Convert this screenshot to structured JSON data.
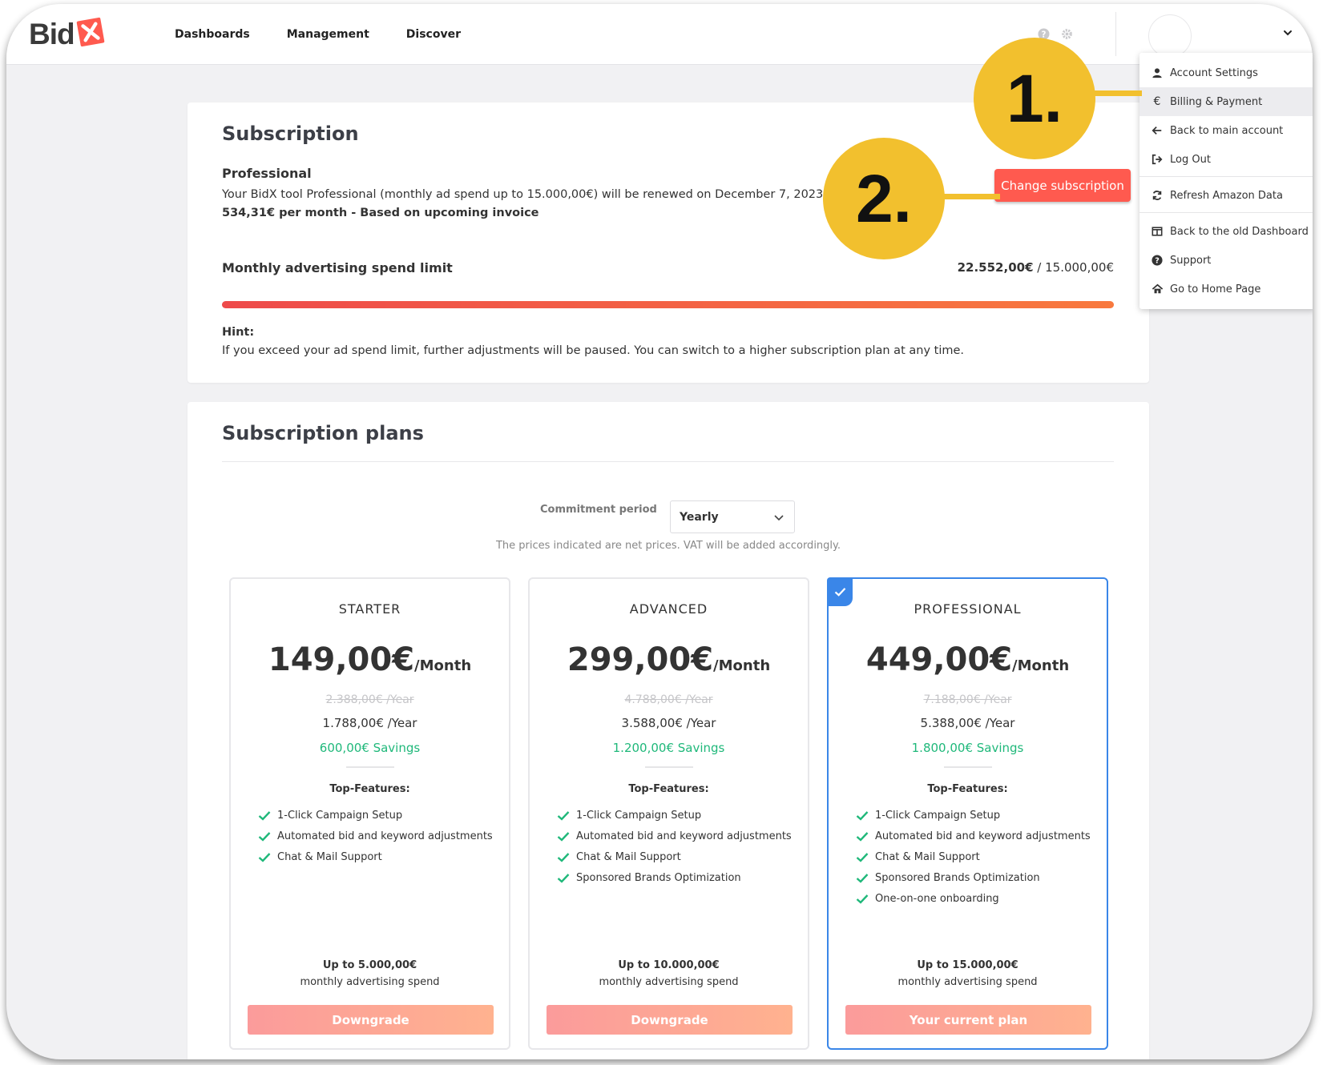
{
  "header": {
    "logo_text": "Bid",
    "logo_mark": "X",
    "nav": [
      "Dashboards",
      "Management",
      "Discover"
    ],
    "icons": [
      "help-icon",
      "gear-icon"
    ]
  },
  "user_menu": {
    "items": [
      {
        "label": "Account Settings",
        "icon": "user-icon"
      },
      {
        "label": "Billing & Payment",
        "icon": "euro-icon"
      },
      {
        "label": "Back to main account",
        "icon": "arrow-left-icon"
      },
      {
        "label": "Log Out",
        "icon": "logout-icon"
      },
      {
        "label": "Refresh Amazon Data",
        "icon": "refresh-icon"
      },
      {
        "label": "Back to the old Dashboard",
        "icon": "columns-icon"
      },
      {
        "label": "Support",
        "icon": "question-icon"
      },
      {
        "label": "Go to Home Page",
        "icon": "home-icon"
      }
    ],
    "active_index": 1
  },
  "annotations": [
    "1.",
    "2."
  ],
  "subscription": {
    "title": "Subscription",
    "plan_name": "Professional",
    "renewal_text": "Your BidX tool Professional (monthly ad spend up to 15.000,00€) will be renewed on December 7, 2023",
    "price_text": "534,31€ per month - Based on upcoming invoice",
    "change_button": "Change subscription",
    "limit_label": "Monthly advertising spend limit",
    "limit_used": "22.552,00€",
    "limit_separator": " / ",
    "limit_total": "15.000,00€",
    "progress_fraction": 1.0,
    "hint_label": "Hint:",
    "hint_text": "If you exceed your ad spend limit, further adjustments will be paused. You can switch to a higher subscription plan at any time."
  },
  "plans_section": {
    "title": "Subscription plans",
    "commitment_label": "Commitment period",
    "commitment_value": "Yearly",
    "vat_note": "The prices indicated are net prices. VAT will be added accordingly.",
    "top_features_label": "Top-Features:",
    "spend_caption": "monthly advertising spend",
    "per_month": "/Month",
    "plans": [
      {
        "name": "STARTER",
        "price": "149,00€",
        "old_year": "2.388,00€ /Year",
        "year": "1.788,00€ /Year",
        "savings": "600,00€ Savings",
        "features": [
          "1-Click Campaign Setup",
          "Automated bid and keyword adjustments",
          "Chat & Mail Support"
        ],
        "limit": "Up to 5.000,00€",
        "button": "Downgrade",
        "current": false
      },
      {
        "name": "ADVANCED",
        "price": "299,00€",
        "old_year": "4.788,00€ /Year",
        "year": "3.588,00€ /Year",
        "savings": "1.200,00€ Savings",
        "features": [
          "1-Click Campaign Setup",
          "Automated bid and keyword adjustments",
          "Chat & Mail Support",
          "Sponsored Brands Optimization"
        ],
        "limit": "Up to 10.000,00€",
        "button": "Downgrade",
        "current": false
      },
      {
        "name": "PROFESSIONAL",
        "price": "449,00€",
        "old_year": "7.188,00€ /Year",
        "year": "5.388,00€ /Year",
        "savings": "1.800,00€ Savings",
        "features": [
          "1-Click Campaign Setup",
          "Automated bid and keyword adjustments",
          "Chat & Mail Support",
          "Sponsored Brands Optimization",
          "One-on-one onboarding"
        ],
        "limit": "Up to 15.000,00€",
        "button": "Your current plan",
        "current": true
      }
    ]
  },
  "colors": {
    "brand_red": "#ff5a4f",
    "savings_green": "#1fb87a",
    "current_blue": "#3a86e8",
    "annotation_yellow": "#f2c02e"
  }
}
